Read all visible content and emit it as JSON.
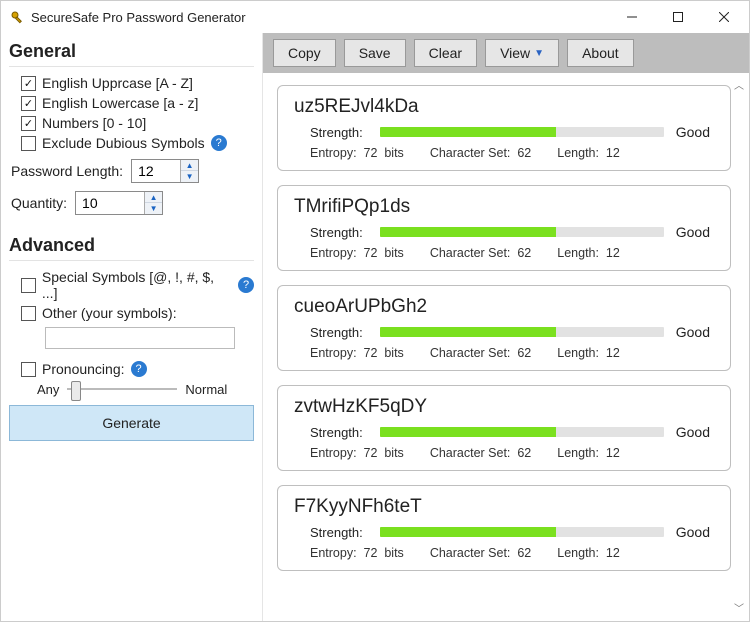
{
  "window": {
    "title": "SecureSafe Pro Password Generator"
  },
  "toolbar": {
    "copy": "Copy",
    "save": "Save",
    "clear": "Clear",
    "view": "View",
    "about": "About"
  },
  "sidebar": {
    "general_title": "General",
    "advanced_title": "Advanced",
    "uppercase_label": "English Upprcase [A - Z]",
    "lowercase_label": "English Lowercase [a - z]",
    "numbers_label": "Numbers [0 - 10]",
    "exclude_label": "Exclude Dubious Symbols",
    "length_label": "Password Length:",
    "length_value": "12",
    "quantity_label": "Quantity:",
    "quantity_value": "10",
    "special_label": "Special Symbols [@, !, #, $, ...]",
    "other_label": "Other (your symbols):",
    "other_value": "",
    "pronouncing_label": "Pronouncing:",
    "slider_left": "Any",
    "slider_right": "Normal",
    "generate": "Generate"
  },
  "labels": {
    "strength": "Strength:",
    "entropy": "Entropy:",
    "bits": "bits",
    "charset": "Character Set:",
    "length": "Length:"
  },
  "results": [
    {
      "password": "uz5REJvl4kDa",
      "entropy": "72",
      "charset": "62",
      "length": "12",
      "rating": "Good",
      "fill": 62
    },
    {
      "password": "TMrifiPQp1ds",
      "entropy": "72",
      "charset": "62",
      "length": "12",
      "rating": "Good",
      "fill": 62
    },
    {
      "password": "cueoArUPbGh2",
      "entropy": "72",
      "charset": "62",
      "length": "12",
      "rating": "Good",
      "fill": 62
    },
    {
      "password": "zvtwHzKF5qDY",
      "entropy": "72",
      "charset": "62",
      "length": "12",
      "rating": "Good",
      "fill": 62
    },
    {
      "password": "F7KyyNFh6teT",
      "entropy": "72",
      "charset": "62",
      "length": "12",
      "rating": "Good",
      "fill": 62
    }
  ]
}
